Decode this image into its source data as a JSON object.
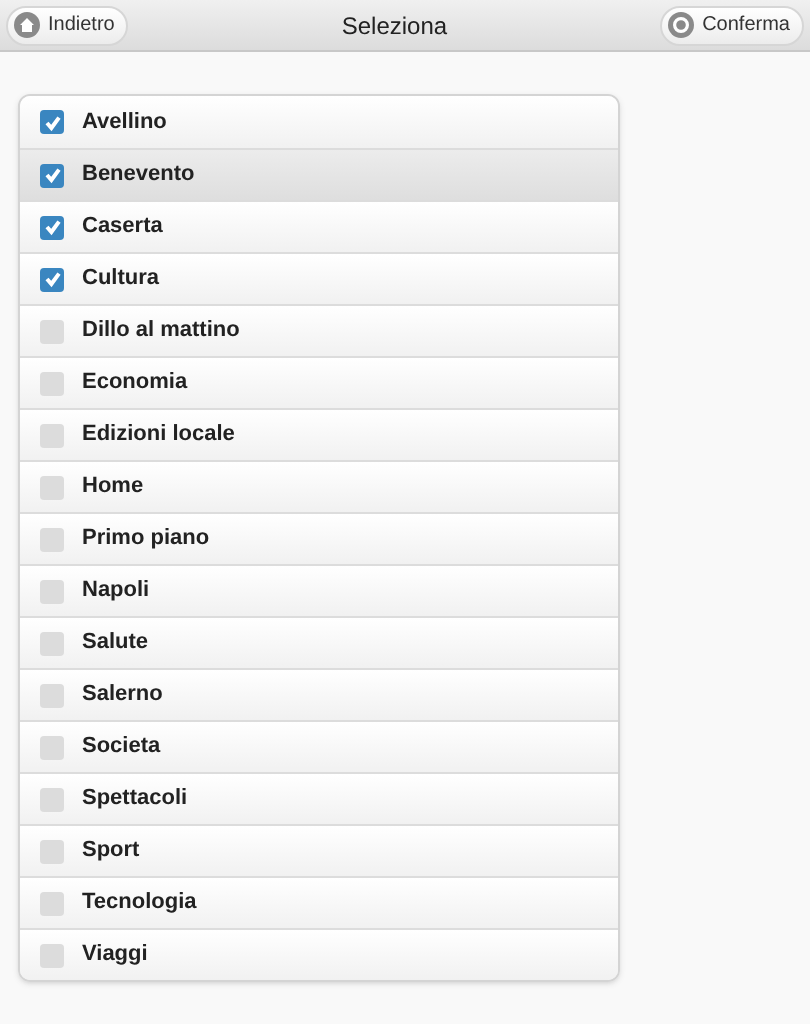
{
  "header": {
    "back_button": "Indietro",
    "title": "Seleziona",
    "confirm_button": "Conferma"
  },
  "items": [
    {
      "label": "Avellino",
      "checked": true,
      "selected": false
    },
    {
      "label": "Benevento",
      "checked": true,
      "selected": true
    },
    {
      "label": "Caserta",
      "checked": true,
      "selected": false
    },
    {
      "label": "Cultura",
      "checked": true,
      "selected": false
    },
    {
      "label": "Dillo al mattino",
      "checked": false,
      "selected": false
    },
    {
      "label": "Economia",
      "checked": false,
      "selected": false
    },
    {
      "label": "Edizioni locale",
      "checked": false,
      "selected": false
    },
    {
      "label": "Home",
      "checked": false,
      "selected": false
    },
    {
      "label": "Primo piano",
      "checked": false,
      "selected": false
    },
    {
      "label": "Napoli",
      "checked": false,
      "selected": false
    },
    {
      "label": "Salute",
      "checked": false,
      "selected": false
    },
    {
      "label": "Salerno",
      "checked": false,
      "selected": false
    },
    {
      "label": "Societa",
      "checked": false,
      "selected": false
    },
    {
      "label": "Spettacoli",
      "checked": false,
      "selected": false
    },
    {
      "label": "Sport",
      "checked": false,
      "selected": false
    },
    {
      "label": "Tecnologia",
      "checked": false,
      "selected": false
    },
    {
      "label": "Viaggi",
      "checked": false,
      "selected": false
    }
  ]
}
